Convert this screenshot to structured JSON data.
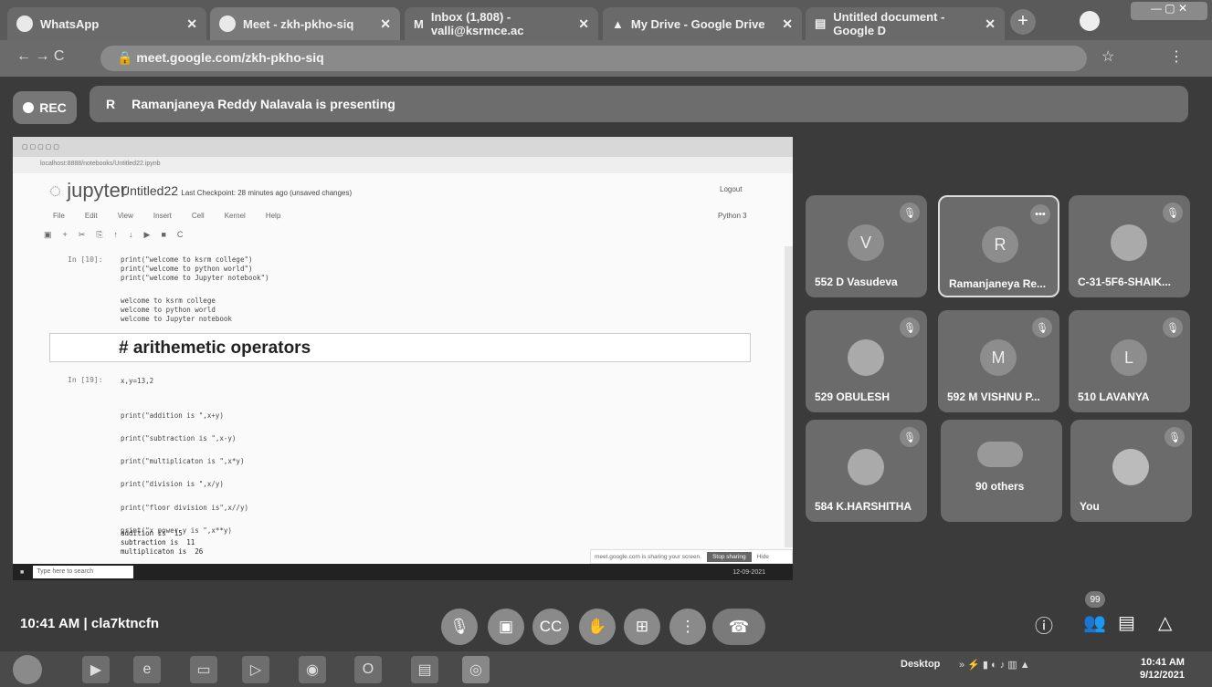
{
  "browser": {
    "tabs": [
      {
        "label": "WhatsApp"
      },
      {
        "label": "Meet - zkh-pkho-siq"
      },
      {
        "label": "Inbox (1,808) - valli@ksrmce.ac"
      },
      {
        "label": "My Drive - Google Drive"
      },
      {
        "label": "Untitled document - Google D"
      }
    ],
    "url": "meet.google.com/zkh-pkho-siq"
  },
  "meet": {
    "rec_label": "REC",
    "presenter_initial": "R",
    "presenting_text": "Ramanjaneya Reddy Nalavala is presenting",
    "time": "10:41 AM",
    "separator": "|",
    "meeting_code": "cla7ktncfn",
    "people_count": "99"
  },
  "shared_screen": {
    "jupyter_logo": "jupyter",
    "notebook_title": "Untitled22",
    "checkpoint": "Last Checkpoint: 28 minutes ago  (unsaved changes)",
    "logout": "Logout",
    "menu": [
      "File",
      "Edit",
      "View",
      "Insert",
      "Cell",
      "Kernel",
      "Help"
    ],
    "kernel": "Python 3",
    "cell1_prompt": "In [10]:",
    "cell1_code": "print(\"welcome to ksrm college\")\nprint(\"welcome to python world\")\nprint(\"welcome to Jupyter notebook\")",
    "cell1_output": "welcome to ksrm college\nwelcome to python world\nwelcome to Jupyter notebook",
    "markdown_text": "# arithemetic operators",
    "cell2_prompt": "In [19]:",
    "cell2_code": "x,y=13,2\n\n\nprint(\"addition is \",x+y)\n\nprint(\"subtraction is \",x-y)\n\nprint(\"multiplicaton is \",x*y)\n\nprint(\"division is \",x/y)\n\nprint(\"floor division is\",x//y)\n\nprint(\"x power y is \",x**y)",
    "cell2_output": "addition is  15\nsubtraction is  11\nmultiplicaton is  26",
    "search_placeholder": "Type here to search",
    "share_notice": "meet.google.com is sharing your screen.",
    "stop_sharing": "Stop sharing",
    "hide": "Hide",
    "taskbar_date": "12-09-2021"
  },
  "participants": [
    {
      "initial": "V",
      "name": "552 D Vasudeva"
    },
    {
      "initial": "R",
      "name": "Ramanjaneya Re..."
    },
    {
      "initial": "",
      "name": "C-31-5F6-SHAIK..."
    },
    {
      "initial": "",
      "name": "529 OBULESH"
    },
    {
      "initial": "M",
      "name": "592 M VISHNU P..."
    },
    {
      "initial": "L",
      "name": "510 LAVANYA"
    },
    {
      "initial": "",
      "name": "584 K.HARSHITHA"
    },
    {
      "initial": "",
      "name": "90 others"
    },
    {
      "initial": "",
      "name": "You"
    }
  ],
  "windows": {
    "desktop_label": "Desktop",
    "time": "10:41 AM",
    "date": "9/12/2021"
  },
  "colors": {
    "background": "#3b3b3b",
    "tile": "#6b6b6b",
    "screen": "#fafafa"
  }
}
